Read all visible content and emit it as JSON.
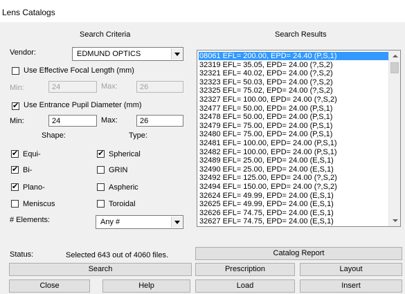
{
  "window": {
    "title": "Lens Catalogs"
  },
  "criteria": {
    "header": "Search Criteria",
    "vendor_label": "Vendor:",
    "vendor_value": "EDMUND OPTICS",
    "efl": {
      "label": "Use Effective Focal Length (mm)",
      "checked": false,
      "min_label": "Min:",
      "min_value": "24",
      "max_label": "Max:",
      "max_value": "26"
    },
    "epd": {
      "label": "Use Entrance Pupil Diameter (mm)",
      "checked": true,
      "min_label": "Min:",
      "min_value": "24",
      "max_label": "Max:",
      "max_value": "26"
    },
    "shape_header": "Shape:",
    "type_header": "Type:",
    "shapes": [
      {
        "label": "Equi-",
        "checked": true
      },
      {
        "label": "Bi-",
        "checked": true
      },
      {
        "label": "Plano-",
        "checked": true
      },
      {
        "label": "Meniscus",
        "checked": false
      }
    ],
    "types": [
      {
        "label": "Spherical",
        "checked": true
      },
      {
        "label": "GRIN",
        "checked": false
      },
      {
        "label": "Aspheric",
        "checked": false
      },
      {
        "label": "Toroidal",
        "checked": false
      }
    ],
    "elements_label": "# Elements:",
    "elements_value": "Any #"
  },
  "results": {
    "header": "Search Results",
    "items": [
      "08061 EFL= 200.00, EPD= 24.40 (P,S,1)",
      "32319 EFL= 35.05, EPD= 24.00 (?,S,2)",
      "32321 EFL= 40.02, EPD= 24.00 (?,S,2)",
      "32323 EFL= 50.03, EPD= 24.00 (?,S,2)",
      "32325 EFL= 75.02, EPD= 24.00 (?,S,2)",
      "32327 EFL= 100.00, EPD= 24.00 (?,S,2)",
      "32477 EFL= 50.00, EPD= 24.00 (P,S,1)",
      "32478 EFL= 50.00, EPD= 24.00 (P,S,1)",
      "32479 EFL= 75.00, EPD= 24.00 (P,S,1)",
      "32480 EFL= 75.00, EPD= 24.00 (P,S,1)",
      "32481 EFL= 100.00, EPD= 24.00 (P,S,1)",
      "32482 EFL= 100.00, EPD= 24.00 (P,S,1)",
      "32489 EFL= 25.00, EPD= 24.00 (E,S,1)",
      "32490 EFL= 25.00, EPD= 24.00 (E,S,1)",
      "32492 EFL= 125.00, EPD= 24.00 (?,S,2)",
      "32494 EFL= 150.00, EPD= 24.00 (?,S,2)",
      "32624 EFL= 49.99, EPD= 24.00 (E,S,1)",
      "32625 EFL= 49.99, EPD= 24.00 (E,S,1)",
      "32626 EFL= 74.75, EPD= 24.00 (E,S,1)",
      "32627 EFL= 74.75, EPD= 24.00 (E,S,1)"
    ],
    "selected_index": 0
  },
  "status": {
    "label": "Status:",
    "text": "Selected 643 out of 4060 files."
  },
  "buttons": {
    "search": "Search",
    "close": "Close",
    "help": "Help",
    "catalog_report": "Catalog Report",
    "prescription": "Prescription",
    "layout": "Layout",
    "load": "Load",
    "insert": "Insert"
  }
}
